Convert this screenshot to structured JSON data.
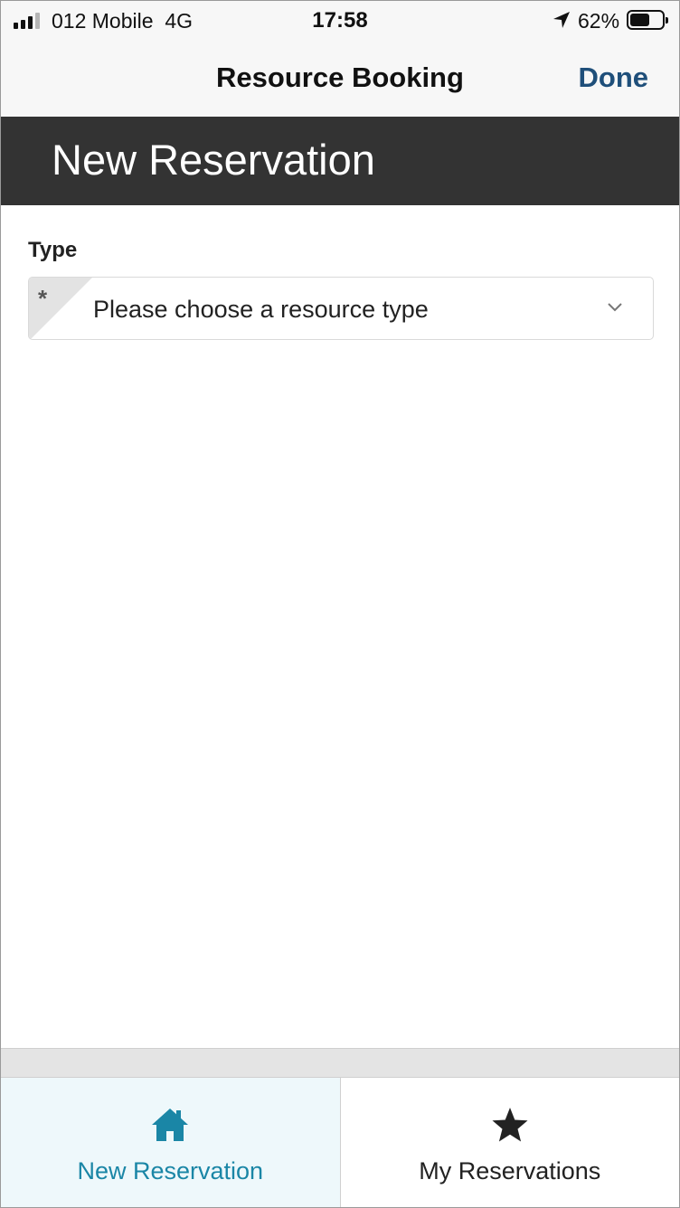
{
  "status_bar": {
    "carrier": "012 Mobile",
    "network": "4G",
    "time": "17:58",
    "battery_percent": "62%",
    "battery_level": 0.62,
    "icons": [
      "signal-icon",
      "location-arrow-icon",
      "battery-icon"
    ]
  },
  "nav_bar": {
    "title": "Resource Booking",
    "done_label": "Done"
  },
  "page": {
    "title": "New Reservation"
  },
  "form": {
    "type_label": "Type",
    "type_select": {
      "placeholder": "Please choose a resource type",
      "required_marker": "*",
      "icon": "chevron-down-icon"
    }
  },
  "tabs": [
    {
      "label": "New Reservation",
      "icon": "home-icon",
      "active": true
    },
    {
      "label": "My Reservations",
      "icon": "star-icon",
      "active": false
    }
  ],
  "colors": {
    "accent": "#1a86a6",
    "done_blue": "#1f4f7a",
    "header_dark": "#333333",
    "active_tab_bg": "#eef8fb"
  }
}
